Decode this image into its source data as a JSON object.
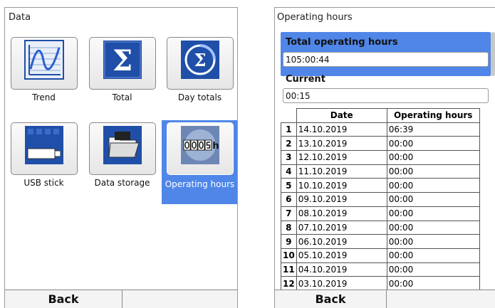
{
  "data_screen": {
    "title": "Data",
    "tiles": [
      {
        "label": "Trend",
        "icon": "trend-icon",
        "selected": false
      },
      {
        "label": "Total",
        "icon": "sigma-icon",
        "selected": false
      },
      {
        "label": "Day totals",
        "icon": "day-totals-icon",
        "selected": false
      },
      {
        "label": "USB stick",
        "icon": "usb-stick-icon",
        "selected": false
      },
      {
        "label": "Data storage",
        "icon": "folder-icon",
        "selected": false
      },
      {
        "label": "Operating hours",
        "icon": "hour-counter-icon",
        "selected": true
      }
    ],
    "back_label": "Back"
  },
  "hours_screen": {
    "title": "Operating hours",
    "total_label": "Total operating hours",
    "total_value": "105:00:44",
    "current_label": "Current",
    "current_value": "00:15",
    "table": {
      "headers": [
        "Date",
        "Operating hours"
      ],
      "rows": [
        {
          "n": "1",
          "date": "14.10.2019",
          "hours": "06:39"
        },
        {
          "n": "2",
          "date": "13.10.2019",
          "hours": "00:00"
        },
        {
          "n": "3",
          "date": "12.10.2019",
          "hours": "00:00"
        },
        {
          "n": "4",
          "date": "11.10.2019",
          "hours": "00:00"
        },
        {
          "n": "5",
          "date": "10.10.2019",
          "hours": "00:00"
        },
        {
          "n": "6",
          "date": "09.10.2019",
          "hours": "00:00"
        },
        {
          "n": "7",
          "date": "08.10.2019",
          "hours": "00:00"
        },
        {
          "n": "8",
          "date": "07.10.2019",
          "hours": "00:00"
        },
        {
          "n": "9",
          "date": "06.10.2019",
          "hours": "00:00"
        },
        {
          "n": "10",
          "date": "05.10.2019",
          "hours": "00:00"
        },
        {
          "n": "11",
          "date": "04.10.2019",
          "hours": "00:00"
        },
        {
          "n": "12",
          "date": "03.10.2019",
          "hours": "00:00"
        }
      ]
    },
    "back_label": "Back"
  },
  "colors": {
    "selection": "#4f86e8",
    "icon_blue": "#1f4fa8",
    "border": "#9a9a9a"
  }
}
